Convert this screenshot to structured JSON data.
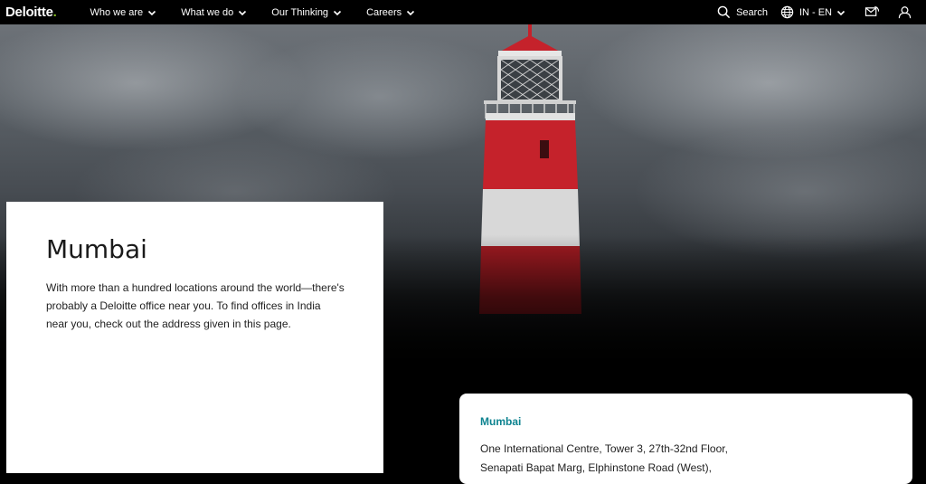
{
  "nav": {
    "logo": "Deloitte",
    "logo_dot": ".",
    "menu": [
      {
        "label": "Who we are"
      },
      {
        "label": "What we do"
      },
      {
        "label": "Our Thinking"
      },
      {
        "label": "Careers"
      }
    ],
    "search_label": "Search",
    "locale_label": "IN - EN",
    "icons": [
      "search-icon",
      "globe-icon",
      "chevron-down-icon",
      "contact-icon",
      "user-icon"
    ]
  },
  "hero": {
    "image": "lighthouse-image",
    "title": "Mumbai",
    "intro": "With more than a hundred locations around the world—there's probably a Deloitte office near you. To find offices in India near you, check out the address given in this page."
  },
  "office": {
    "name": "Mumbai",
    "address_line1": "One International Centre, Tower 3, 27th-32nd Floor,",
    "address_line2": "Senapati Bapat Marg, Elphinstone Road (West),"
  },
  "colors": {
    "nav_bg": "#000000",
    "accent": "#86bc25",
    "link": "#0d8390",
    "lighthouse_red": "#c5222b"
  }
}
